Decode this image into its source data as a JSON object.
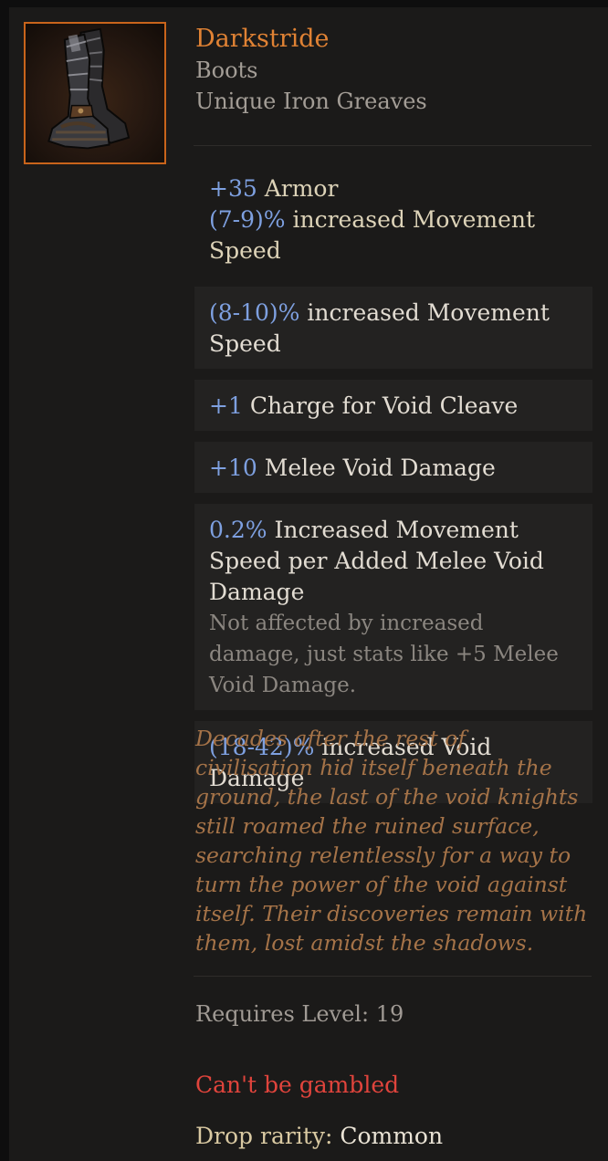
{
  "item": {
    "name": "Darkstride",
    "base": "Boots",
    "subtype": "Unique Iron Greaves",
    "icon": "iron-greaves-icon",
    "rarity_color": "#e08234"
  },
  "implicit": {
    "line1_value": "+35",
    "line1_text": "Armor",
    "line2_value": "(7-9)%",
    "line2_text": "increased Movement Speed"
  },
  "mods": [
    {
      "value": "(8-10)%",
      "text": "increased Movement Speed"
    },
    {
      "value": "+1",
      "text": "Charge for Void Cleave"
    },
    {
      "value": "+10",
      "text": "Melee Void Damage"
    },
    {
      "value": "0.2%",
      "text": "Increased Movement Speed per Added Melee Void Damage",
      "note": "Not affected by increased damage, just stats like +5 Melee Void Damage."
    },
    {
      "value": "(18-42)%",
      "text": "increased Void Damage"
    }
  ],
  "flavor": "Decades after the rest of civilisation hid itself beneath the ground, the last of the void knights still roamed the ruined surface, searching relentlessly for a way to turn the power of the void against itself. Their discoveries remain with them, lost amidst the shadows.",
  "requirement": {
    "label": "Requires Level:",
    "value": "19"
  },
  "gamble": "Can't be gambled",
  "drop": {
    "label": "Drop rarity:",
    "value": "Common"
  }
}
